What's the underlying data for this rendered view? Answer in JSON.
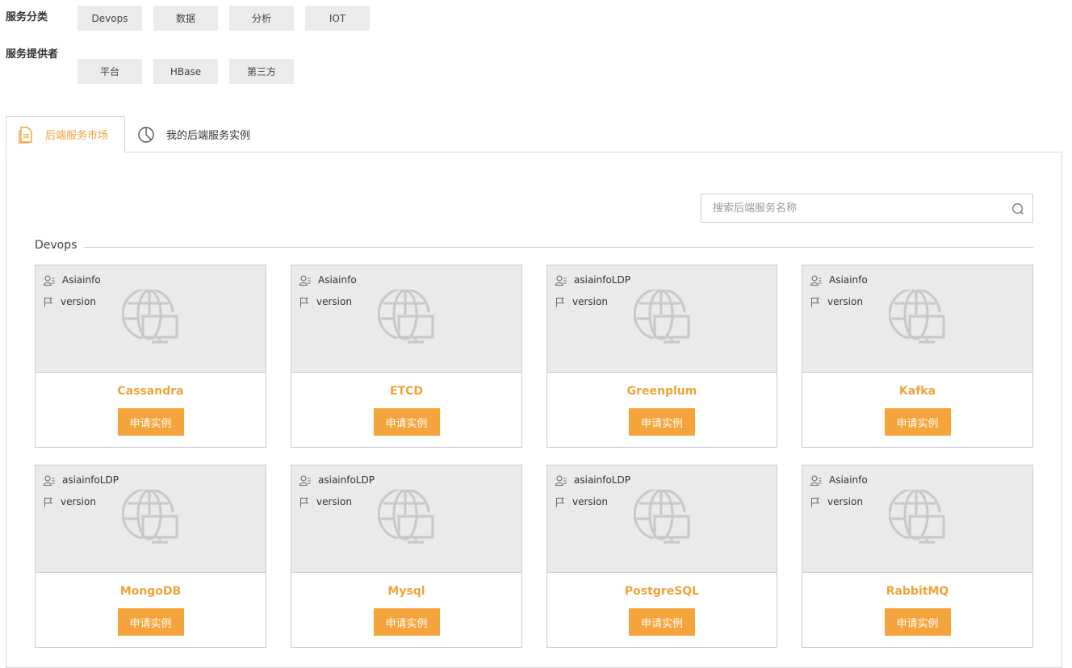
{
  "filters": {
    "category": {
      "label": "服务分类",
      "options": [
        "Devops",
        "数据",
        "分析",
        "IOT"
      ]
    },
    "provider": {
      "label": "服务提供者",
      "options": [
        "平台",
        "HBase",
        "第三方"
      ]
    }
  },
  "tabs": [
    {
      "label": "后端服务市场",
      "icon": "document-icon",
      "active": true
    },
    {
      "label": "我的后端服务实例",
      "icon": "pie-chart-icon",
      "active": false
    }
  ],
  "search": {
    "placeholder": "搜索后端服务名称",
    "value": ""
  },
  "section": {
    "title": "Devops"
  },
  "accent_color": "#f5a43c",
  "cards": [
    {
      "provider": "Asiainfo",
      "version": "version",
      "name": "Cassandra",
      "button": "申请实例"
    },
    {
      "provider": "Asiainfo",
      "version": "version",
      "name": "ETCD",
      "button": "申请实例"
    },
    {
      "provider": "asiainfoLDP",
      "version": "version",
      "name": "Greenplum",
      "button": "申请实例"
    },
    {
      "provider": "Asiainfo",
      "version": "version",
      "name": "Kafka",
      "button": "申请实例"
    },
    {
      "provider": "asiainfoLDP",
      "version": "version",
      "name": "MongoDB",
      "button": "申请实例"
    },
    {
      "provider": "asiainfoLDP",
      "version": "version",
      "name": "Mysql",
      "button": "申请实例"
    },
    {
      "provider": "asiainfoLDP",
      "version": "version",
      "name": "PostgreSQL",
      "button": "申请实例"
    },
    {
      "provider": "Asiainfo",
      "version": "version",
      "name": "RabbitMQ",
      "button": "申请实例"
    }
  ]
}
